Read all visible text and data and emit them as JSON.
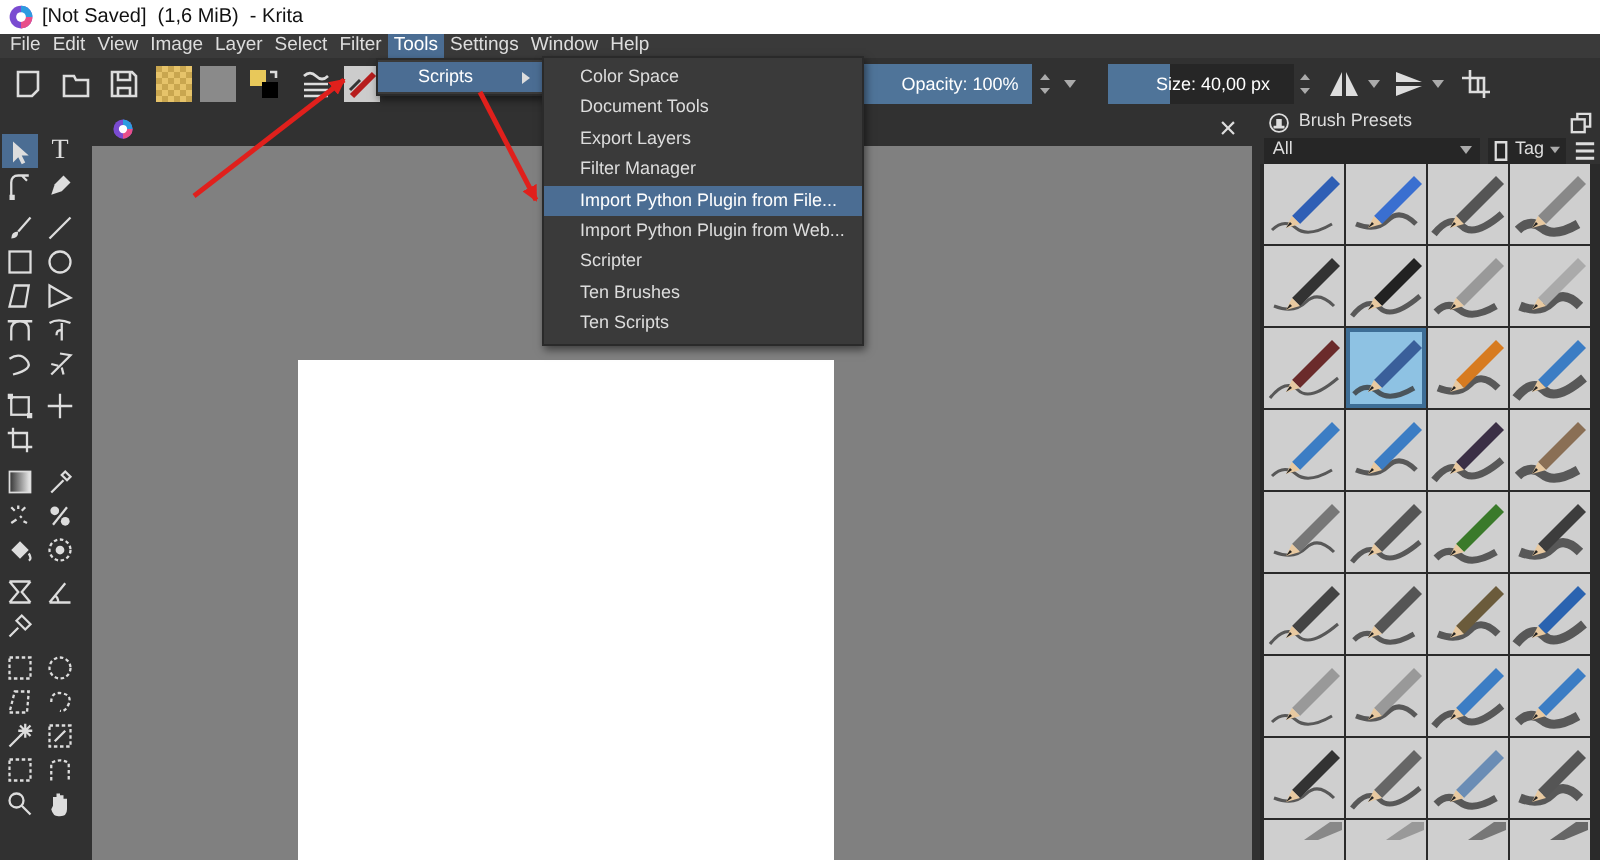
{
  "title_bar": {
    "title": "[Not Saved]  (1,6 MiB)  - Krita"
  },
  "menu_bar": [
    {
      "label": "File",
      "selected": false
    },
    {
      "label": "Edit",
      "selected": false
    },
    {
      "label": "View",
      "selected": false
    },
    {
      "label": "Image",
      "selected": false
    },
    {
      "label": "Layer",
      "selected": false
    },
    {
      "label": "Select",
      "selected": false
    },
    {
      "label": "Filter",
      "selected": false
    },
    {
      "label": "Tools",
      "selected": true
    },
    {
      "label": "Settings",
      "selected": false
    },
    {
      "label": "Window",
      "selected": false
    },
    {
      "label": "Help",
      "selected": false
    }
  ],
  "tools_menu": [
    {
      "label": "Scripts",
      "selected": true,
      "has_submenu": true
    }
  ],
  "scripts_submenu": [
    {
      "label": "Color Space",
      "selected": false
    },
    {
      "label": "Document Tools",
      "selected": false
    },
    {
      "label": "Export Layers",
      "selected": false
    },
    {
      "label": "Filter Manager",
      "selected": false
    },
    {
      "label": "Import Python Plugin from File...",
      "selected": true
    },
    {
      "label": "Import Python Plugin from Web...",
      "selected": false
    },
    {
      "label": "Scripter",
      "selected": false
    },
    {
      "label": "Ten Brushes",
      "selected": false
    },
    {
      "label": "Ten Scripts",
      "selected": false
    }
  ],
  "toolbar": {
    "opacity": {
      "label": "Opacity: 100%",
      "level": 1
    },
    "size": {
      "label": "Size: 40,00 px",
      "level": 0.33
    }
  },
  "toolbox": [
    [
      [
        {
          "kind": "pointer",
          "selected": true
        },
        {
          "kind": "text",
          "label": "T",
          "selected": false
        }
      ],
      [
        {
          "kind": "node-edit",
          "selected": false
        },
        {
          "kind": "nib",
          "selected": false
        }
      ]
    ],
    [
      [
        {
          "kind": "brush",
          "selected": false
        },
        {
          "kind": "line",
          "selected": false
        }
      ],
      [
        {
          "kind": "rectangle",
          "selected": false
        },
        {
          "kind": "ellipse",
          "selected": false
        }
      ],
      [
        {
          "kind": "polygon",
          "selected": false
        },
        {
          "kind": "polyline",
          "selected": false
        }
      ],
      [
        {
          "kind": "bezier",
          "selected": false
        },
        {
          "kind": "freehand-path",
          "selected": false
        }
      ],
      [
        {
          "kind": "dynamic",
          "selected": false
        },
        {
          "kind": "multibrush",
          "selected": false
        }
      ]
    ],
    [
      [
        {
          "kind": "transform",
          "selected": false
        },
        {
          "kind": "move",
          "selected": false
        }
      ],
      [
        {
          "kind": "crop",
          "selected": false
        }
      ]
    ],
    [
      [
        {
          "kind": "gradient",
          "selected": false
        },
        {
          "kind": "picker",
          "selected": false
        }
      ],
      [
        {
          "kind": "patch",
          "selected": false
        },
        {
          "kind": "colorize",
          "selected": false
        }
      ],
      [
        {
          "kind": "fill",
          "selected": false
        },
        {
          "kind": "enclose",
          "selected": false
        }
      ]
    ],
    [
      [
        {
          "kind": "assistant",
          "selected": false
        },
        {
          "kind": "measure",
          "selected": false
        }
      ],
      [
        {
          "kind": "pin",
          "selected": false
        }
      ]
    ],
    [
      [
        {
          "kind": "rect-select",
          "selected": false
        },
        {
          "kind": "ellipse-select",
          "selected": false
        }
      ],
      [
        {
          "kind": "polygon-select",
          "selected": false
        },
        {
          "kind": "freehand-select",
          "selected": false
        }
      ],
      [
        {
          "kind": "wand-select",
          "selected": false
        },
        {
          "kind": "similar-select",
          "selected": false
        }
      ],
      [
        {
          "kind": "bezier-select",
          "selected": false
        },
        {
          "kind": "magnetic-select",
          "selected": false
        }
      ],
      [
        {
          "kind": "zoom",
          "selected": false
        },
        {
          "kind": "pan",
          "selected": false
        }
      ]
    ]
  ],
  "document_tab": {
    "close": "×"
  },
  "brush_presets": {
    "title": "Brush Presets",
    "filter": "All",
    "tag": "Tag",
    "presets": [
      {
        "selected": false
      },
      {
        "selected": false
      },
      {
        "selected": false
      },
      {
        "selected": false
      },
      {
        "selected": false
      },
      {
        "selected": false
      },
      {
        "selected": false
      },
      {
        "selected": false
      },
      {
        "selected": false
      },
      {
        "selected": true
      },
      {
        "selected": false
      },
      {
        "selected": false
      },
      {
        "selected": false
      },
      {
        "selected": false
      },
      {
        "selected": false
      },
      {
        "selected": false
      },
      {
        "selected": false
      },
      {
        "selected": false
      },
      {
        "selected": false
      },
      {
        "selected": false
      },
      {
        "selected": false
      },
      {
        "selected": false
      },
      {
        "selected": false
      },
      {
        "selected": false
      },
      {
        "selected": false
      },
      {
        "selected": false
      },
      {
        "selected": false
      },
      {
        "selected": false
      },
      {
        "selected": false
      },
      {
        "selected": false
      },
      {
        "selected": false
      },
      {
        "selected": false
      },
      {
        "selected": false
      },
      {
        "selected": false
      },
      {
        "selected": false
      },
      {
        "selected": false
      }
    ]
  }
}
